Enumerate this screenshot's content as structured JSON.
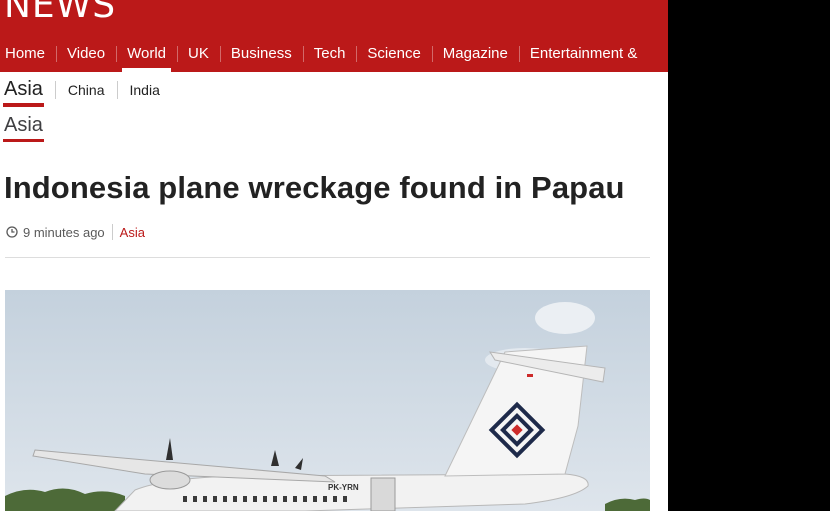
{
  "brand": {
    "logo_text": "NEWS"
  },
  "nav": {
    "items": [
      {
        "label": "Home"
      },
      {
        "label": "Video"
      },
      {
        "label": "World"
      },
      {
        "label": "UK"
      },
      {
        "label": "Business"
      },
      {
        "label": "Tech"
      },
      {
        "label": "Science"
      },
      {
        "label": "Magazine"
      },
      {
        "label": "Entertainment & Arts"
      }
    ],
    "active": "World"
  },
  "subnav": {
    "current": "Asia",
    "links": [
      {
        "label": "China"
      },
      {
        "label": "India"
      }
    ]
  },
  "article": {
    "section": "Asia",
    "headline": "Indonesia plane wreckage found in Papau",
    "timestamp": "9 minutes ago",
    "section_link": "Asia",
    "photo": {
      "registration": "PK-YRN"
    }
  },
  "icons": {
    "timestamp": "clock-icon"
  },
  "colors": {
    "brand_red": "#bb1919",
    "text": "#222222",
    "muted": "#5a5a5a"
  }
}
